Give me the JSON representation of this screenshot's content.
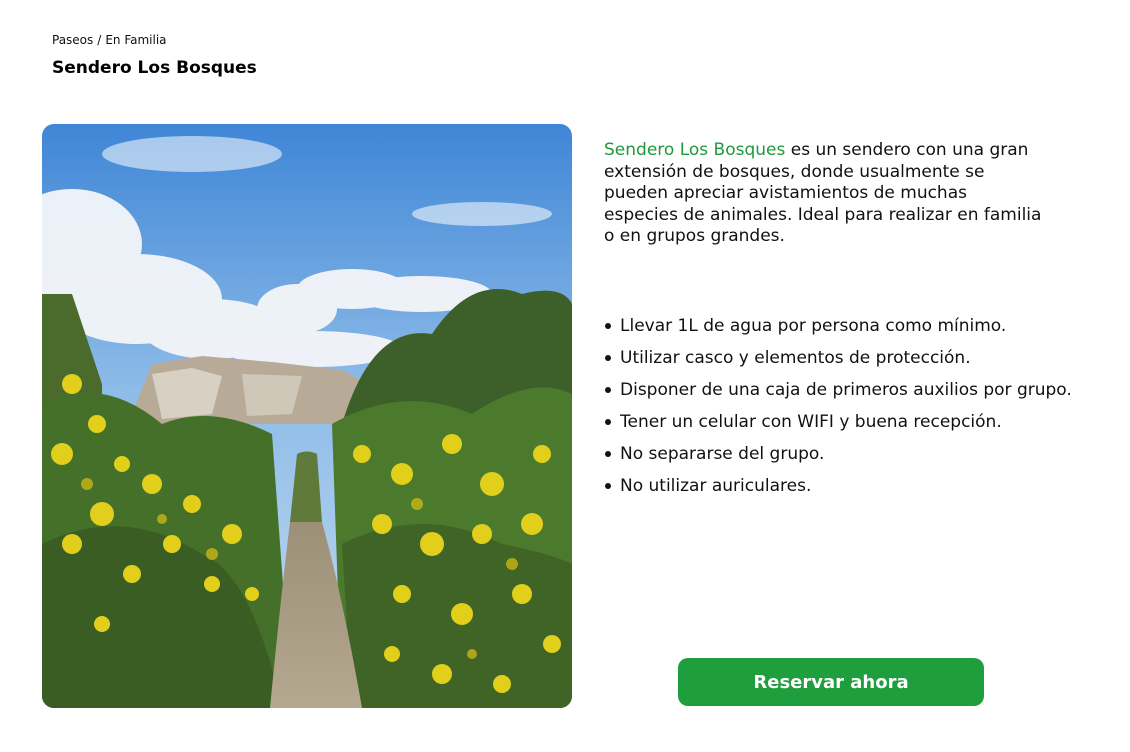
{
  "breadcrumb": {
    "items": [
      "Paseos",
      "En Familia"
    ],
    "separator": "/"
  },
  "page_title": "Sendero Los Bosques",
  "photo": {
    "subject": "trail-through-yellow-flowering-shrubs"
  },
  "description": {
    "highlight": "Sendero Los Bosques",
    "text": " es un sendero con una gran extensión de bosques, donde usualmente se pueden apreciar avistamientos de muchas especies de animales. Ideal para realizar en familia o en grupos grandes."
  },
  "rules": [
    "Llevar 1L de agua por persona como mínimo.",
    "Utilizar casco y elementos de protección.",
    "Disponer de una caja de primeros auxilios por grupo.",
    "Tener un celular con WIFI y buena recepción.",
    "No separarse del grupo.",
    "No utilizar auriculares."
  ],
  "reserve_button": {
    "label": "Reservar ahora"
  },
  "colors": {
    "accent": "#1e9e3c",
    "highlight_text": "#1f9a3a",
    "text": "#111111",
    "background": "#ffffff"
  }
}
